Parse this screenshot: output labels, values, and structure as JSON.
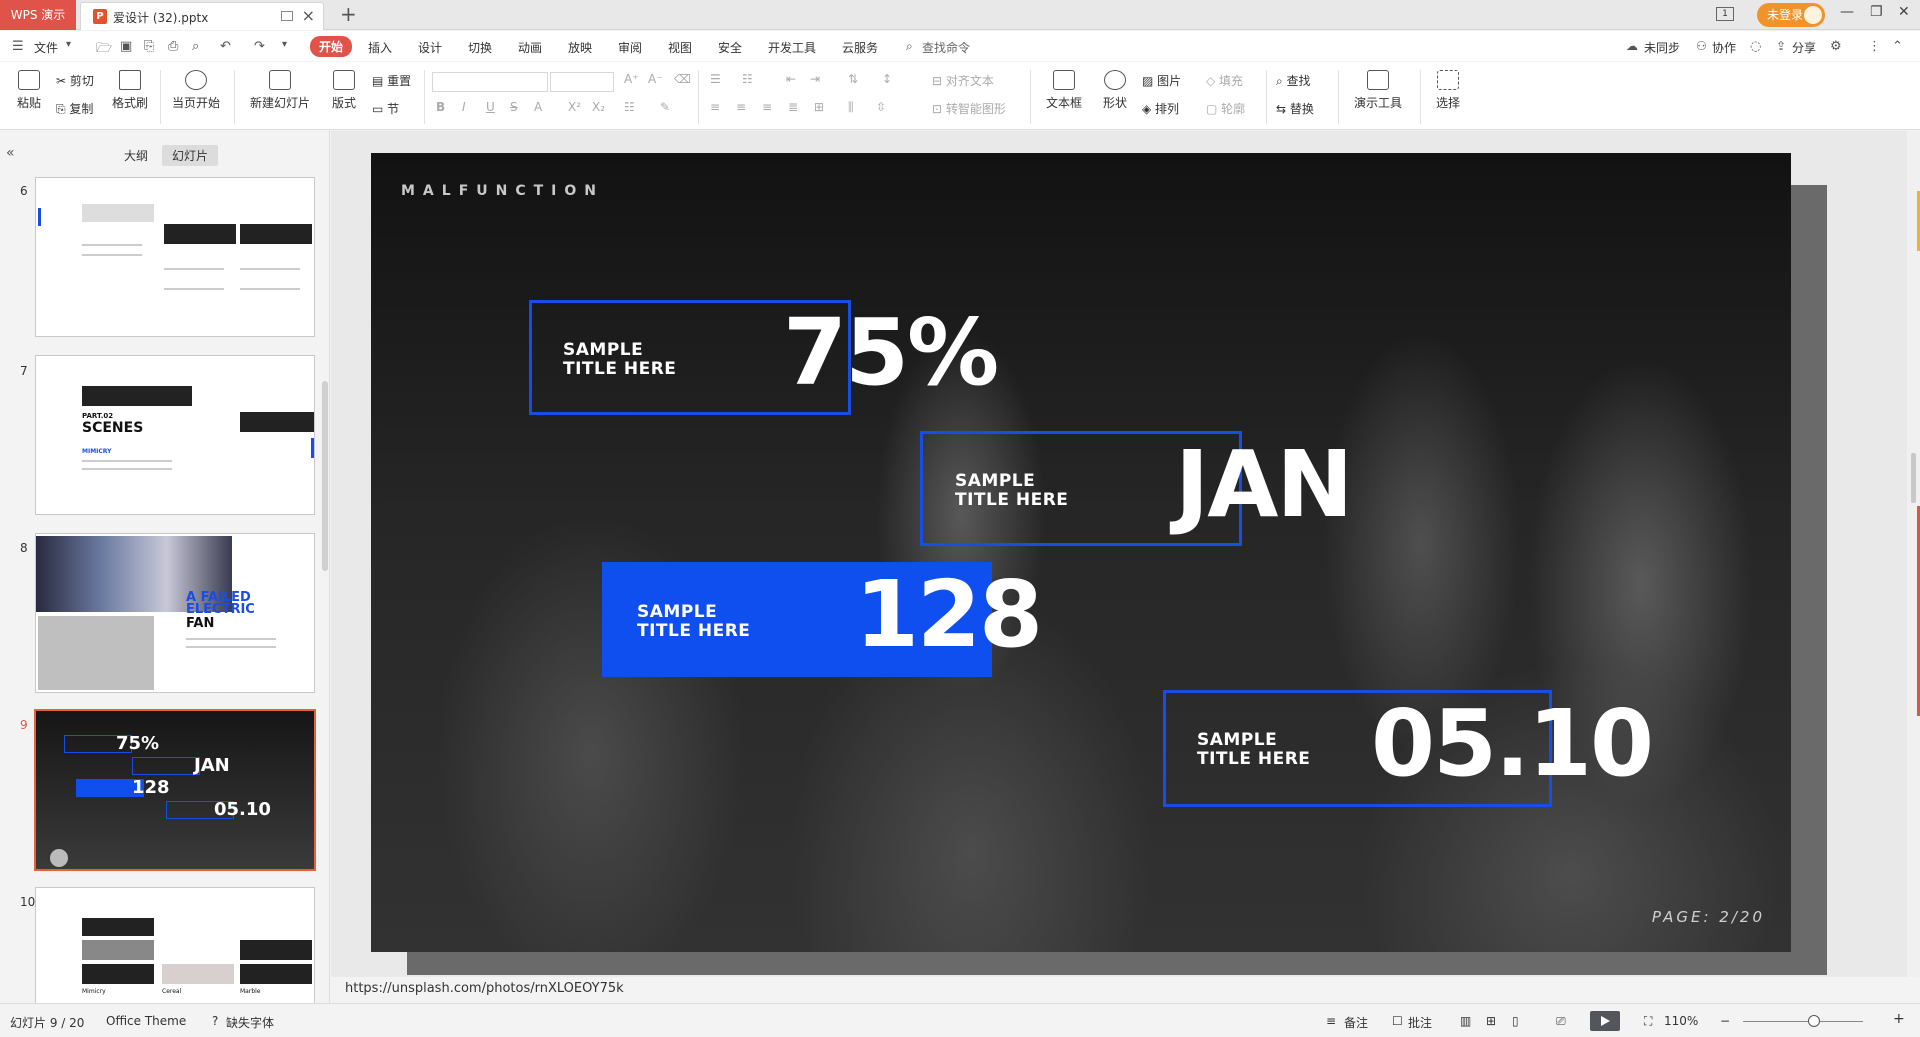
{
  "titlebar": {
    "app_label": "WPS 演示",
    "doc_icon": "P",
    "doc_name": "爱设计 (32).pptx",
    "login_label": "未登录"
  },
  "menubar": {
    "items": [
      "文件",
      "开始",
      "插入",
      "设计",
      "切换",
      "动画",
      "放映",
      "审阅",
      "视图",
      "安全",
      "开发工具",
      "云服务"
    ],
    "search": "查找命令",
    "right": [
      "未同步",
      "协作",
      "分享"
    ]
  },
  "ribbon": {
    "paste": "粘贴",
    "cut": "剪切",
    "copy": "复制",
    "format_painter": "格式刷",
    "from_current": "当页开始",
    "new_slide": "新建幻灯片",
    "layout": "版式",
    "reset": "重置",
    "section": "节",
    "align_text": "对齐文本",
    "smart_graphic": "转智能图形",
    "textbox": "文本框",
    "shape": "形状",
    "picture": "图片",
    "arrange": "排列",
    "fill": "填充",
    "outline": "轮廓",
    "find": "查找",
    "replace": "替换",
    "presentation_tools": "演示工具",
    "select": "选择"
  },
  "leftpanel": {
    "tabs": [
      "大纲",
      "幻灯片"
    ],
    "thumbs": [
      {
        "num": "6"
      },
      {
        "num": "7",
        "part": "PART.02",
        "title": "SCENES",
        "sub": "MIMICRY"
      },
      {
        "num": "8",
        "title1": "A FAILED",
        "title2": "ELECTRIC",
        "title3": "FAN"
      },
      {
        "num": "9",
        "v1": "75%",
        "v2": "JAN",
        "v3": "128",
        "v4": "05.10"
      },
      {
        "num": "10",
        "c1": "Mimicry",
        "c2": "Cereal",
        "c3": "Marble"
      }
    ]
  },
  "slide": {
    "brand": "MALFUNCTION",
    "page": "PAGE: 2/20",
    "stats": [
      {
        "label1": "SAMPLE",
        "label2": "TITLE HERE",
        "value": "75%"
      },
      {
        "label1": "SAMPLE",
        "label2": "TITLE HERE",
        "value": "JAN"
      },
      {
        "label1": "SAMPLE",
        "label2": "TITLE HERE",
        "value": "128"
      },
      {
        "label1": "SAMPLE",
        "label2": "TITLE HERE",
        "value": "05.10"
      }
    ],
    "accent_color": "#0f4ff0"
  },
  "notes_url": "https://unsplash.com/photos/rnXLOEOY75k",
  "statusbar": {
    "slide_index": "幻灯片 9 / 20",
    "theme": "Office Theme",
    "missing_font": "缺失字体",
    "notes": "备注",
    "comments": "批注",
    "zoom": "110%"
  }
}
